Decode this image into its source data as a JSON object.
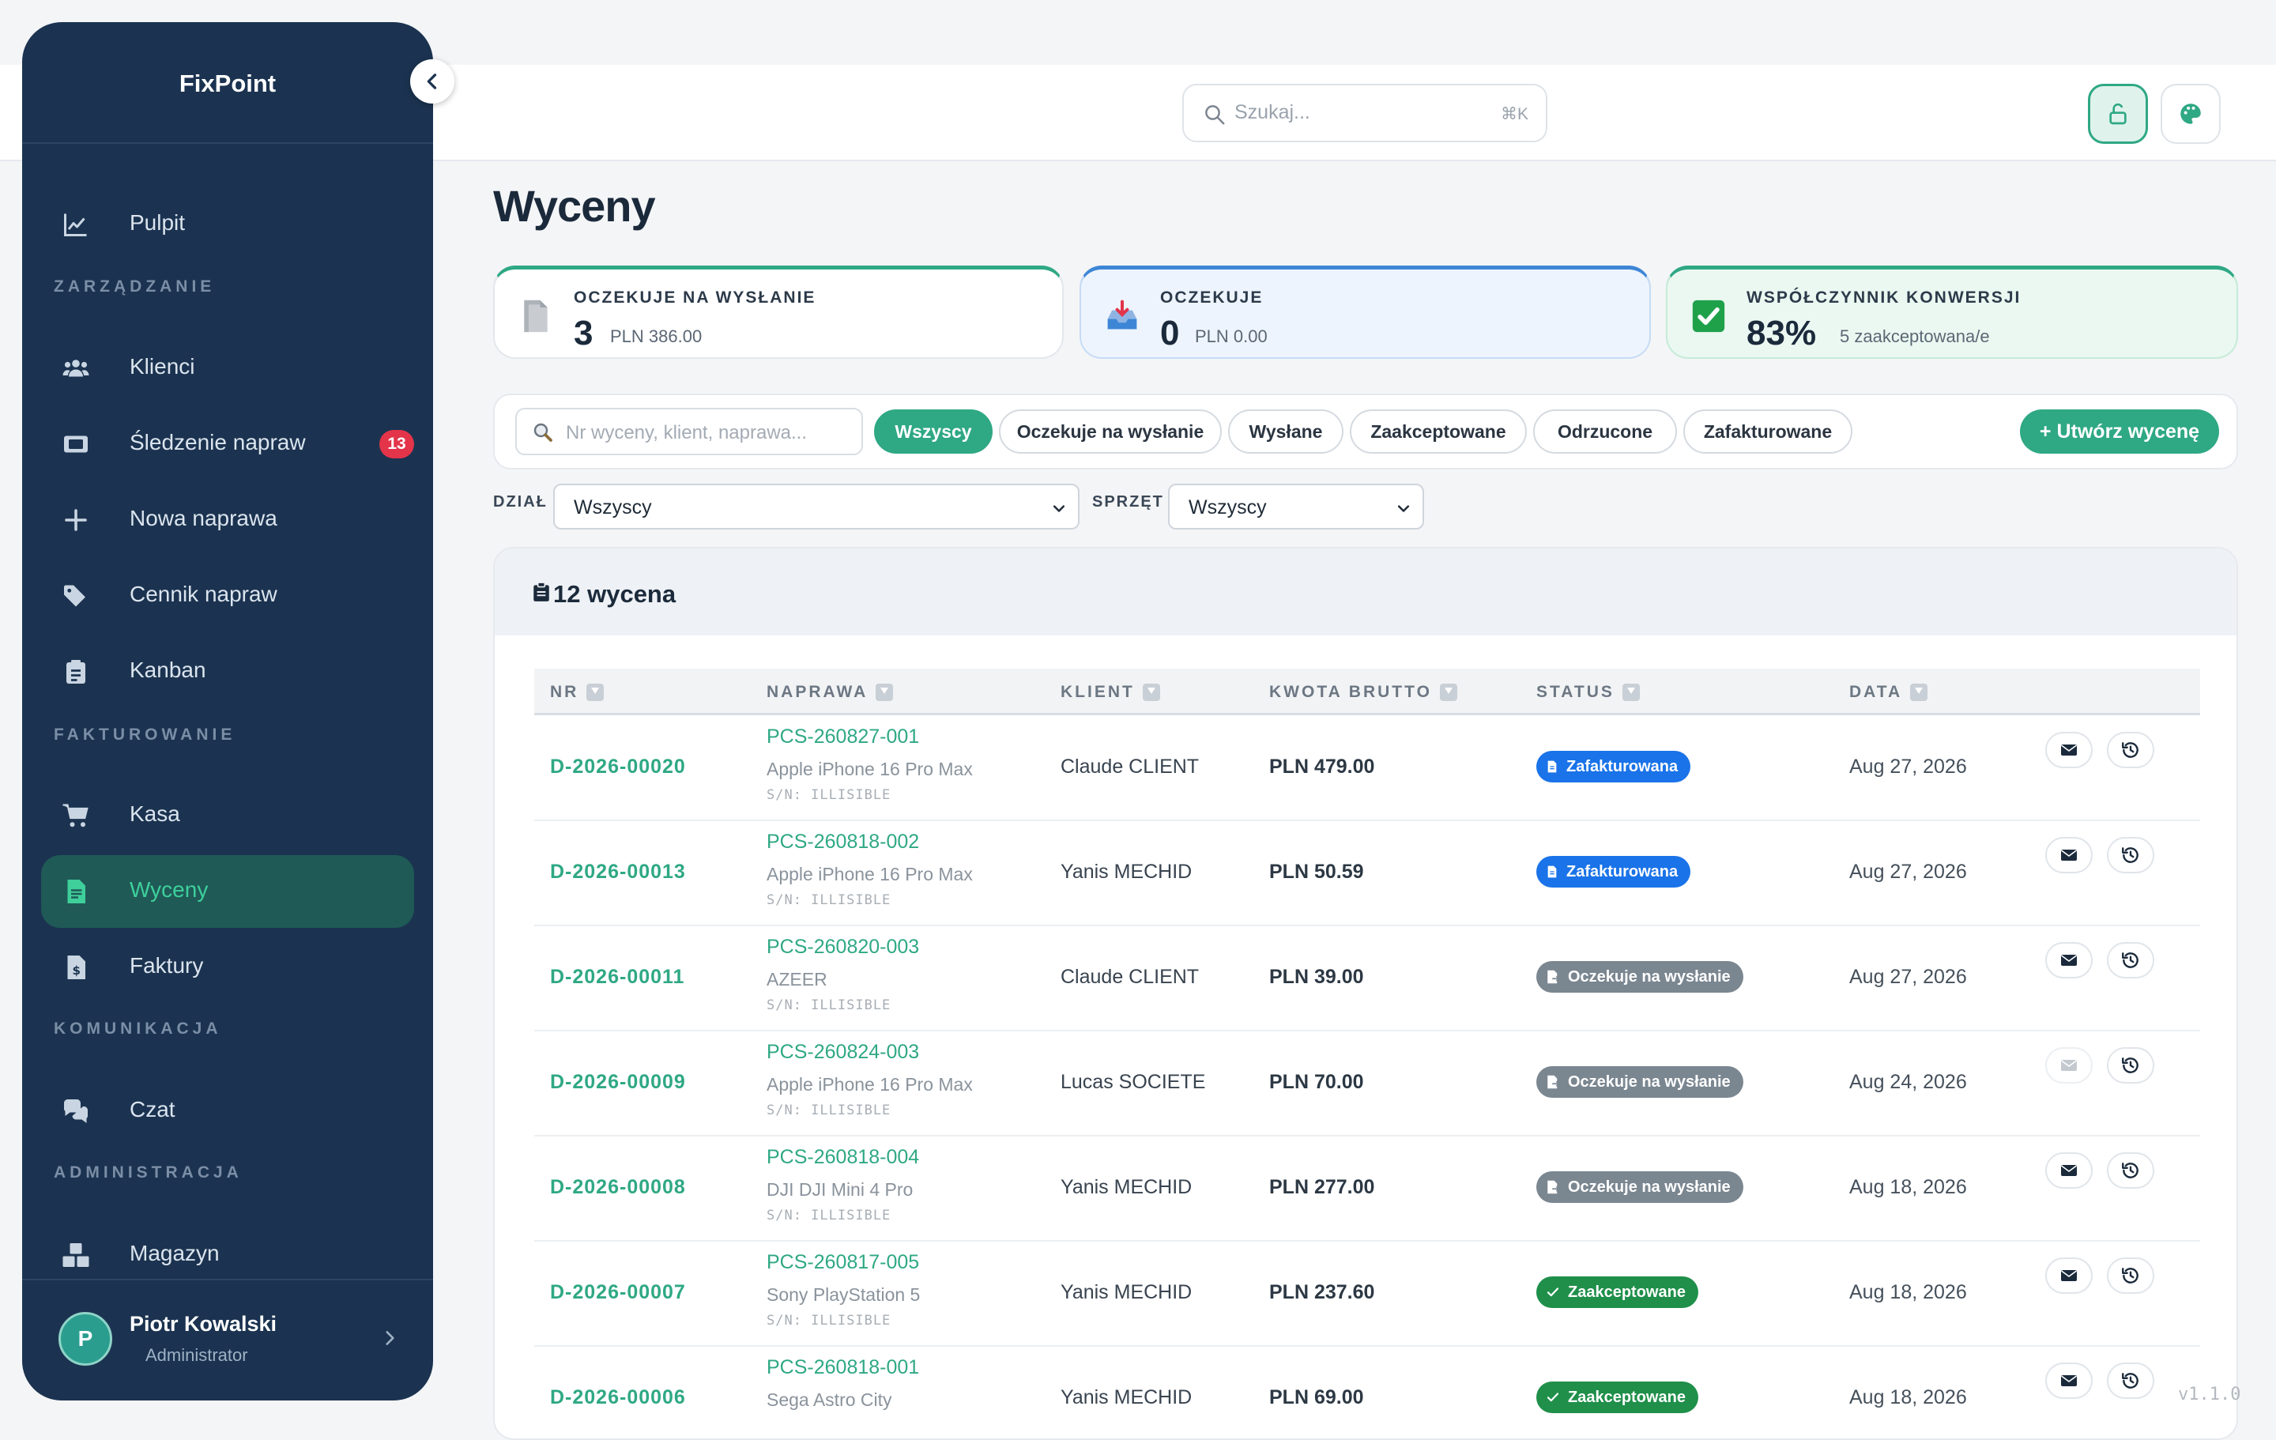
{
  "app": {
    "brand": "FixPoint",
    "version": "v1.1.0"
  },
  "topbar": {
    "search_placeholder": "Szukaj...",
    "search_shortcut": "⌘K"
  },
  "sidebar": {
    "sections": {
      "zarzadzanie": "ZARZĄDZANIE",
      "fakturowanie": "FAKTUROWANIE",
      "komunikacja": "KOMUNIKACJA",
      "administracja": "ADMINISTRACJA"
    },
    "items": {
      "pulpit": "Pulpit",
      "klienci": "Klienci",
      "sledzenie": "Śledzenie napraw",
      "sledzenie_badge": "13",
      "nowa": "Nowa naprawa",
      "cennik": "Cennik napraw",
      "kanban": "Kanban",
      "kasa": "Kasa",
      "wyceny": "Wyceny",
      "faktury": "Faktury",
      "czat": "Czat",
      "magazyn": "Magazyn"
    },
    "user": {
      "initial": "P",
      "name": "Piotr Kowalski",
      "role": "Administrator"
    }
  },
  "page": {
    "title": "Wyceny"
  },
  "stats": [
    {
      "label": "OCZEKUJE NA WYSŁANIE",
      "value": "3",
      "sub": "PLN 386.00"
    },
    {
      "label": "OCZEKUJE",
      "value": "0",
      "sub": "PLN 0.00"
    },
    {
      "label": "WSPÓŁCZYNNIK KONWERSJI",
      "value": "83%",
      "sub": "5 zaakceptowana/e"
    }
  ],
  "filters": {
    "search_placeholder": "Nr wyceny, klient, naprawa...",
    "pills": [
      "Wszyscy",
      "Oczekuje na wysłanie",
      "Wysłane",
      "Zaakceptowane",
      "Odrzucone",
      "Zafakturowane"
    ],
    "create": "+ Utwórz wycenę",
    "dept_label": "DZIAŁ",
    "dept_value": "Wszyscy",
    "equip_label": "SPRZĘT",
    "equip_value": "Wszyscy"
  },
  "table": {
    "count_title": "12 wycena",
    "headers": [
      "NR",
      "NAPRAWA",
      "KLIENT",
      "KWOTA BRUTTO",
      "STATUS",
      "DATA"
    ],
    "rows": [
      {
        "nr": "D-2026-00020",
        "repair": "PCS-260827-001",
        "device": "Apple iPhone 16 Pro Max",
        "sn": "S/N: ILLISIBLE",
        "client": "Claude CLIENT",
        "amount": "PLN 479.00",
        "status": "Zafakturowana",
        "date": "Aug 27, 2026"
      },
      {
        "nr": "D-2026-00013",
        "repair": "PCS-260818-002",
        "device": "Apple iPhone 16 Pro Max",
        "sn": "S/N: ILLISIBLE",
        "client": "Yanis MECHID",
        "amount": "PLN 50.59",
        "status": "Zafakturowana",
        "date": "Aug 27, 2026"
      },
      {
        "nr": "D-2026-00011",
        "repair": "PCS-260820-003",
        "device": "AZEER",
        "sn": "S/N: ILLISIBLE",
        "client": "Claude CLIENT",
        "amount": "PLN 39.00",
        "status": "Oczekuje na wysłanie",
        "date": "Aug 27, 2026"
      },
      {
        "nr": "D-2026-00009",
        "repair": "PCS-260824-003",
        "device": "Apple iPhone 16 Pro Max",
        "sn": "S/N: ILLISIBLE",
        "client": "Lucas SOCIETE",
        "amount": "PLN 70.00",
        "status": "Oczekuje na wysłanie",
        "date": "Aug 24, 2026"
      },
      {
        "nr": "D-2026-00008",
        "repair": "PCS-260818-004",
        "device": "DJI DJI Mini 4 Pro",
        "sn": "S/N: ILLISIBLE",
        "client": "Yanis MECHID",
        "amount": "PLN 277.00",
        "status": "Oczekuje na wysłanie",
        "date": "Aug 18, 2026"
      },
      {
        "nr": "D-2026-00007",
        "repair": "PCS-260817-005",
        "device": "Sony PlayStation 5",
        "sn": "S/N: ILLISIBLE",
        "client": "Yanis MECHID",
        "amount": "PLN 237.60",
        "status": "Zaakceptowane",
        "date": "Aug 18, 2026"
      },
      {
        "nr": "D-2026-00006",
        "repair": "PCS-260818-001",
        "device": "Sega Astro City",
        "sn": "",
        "client": "Yanis MECHID",
        "amount": "PLN 69.00",
        "status": "Zaakceptowane",
        "date": "Aug 18, 2026"
      }
    ]
  },
  "colors": {
    "sidebar_bg": "#1b3350",
    "accent": "#2fa884",
    "invoiced": "#1a73e8",
    "pending": "#7a8690",
    "accepted": "#1f8f4a",
    "badge": "#e3344a"
  }
}
